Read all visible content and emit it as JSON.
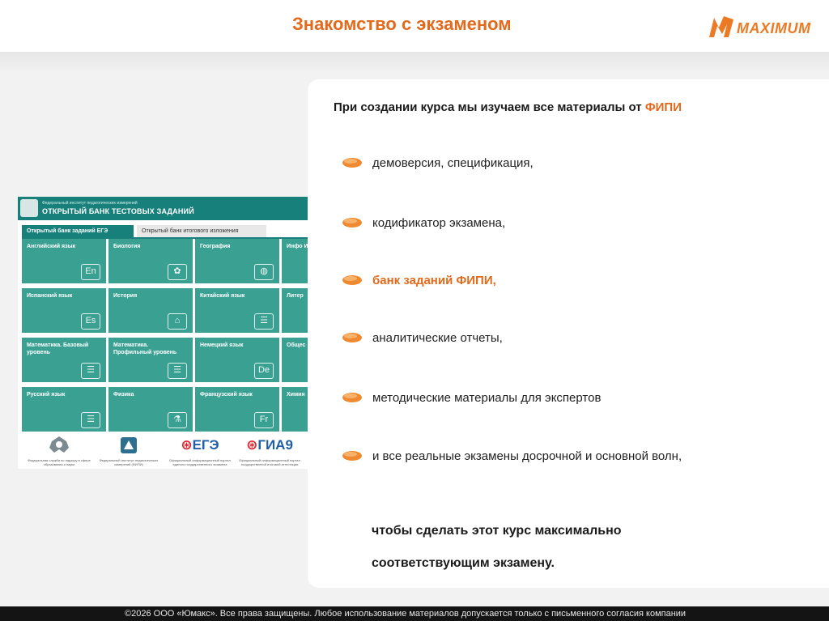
{
  "slide": {
    "title": "Знакомство с экзаменом",
    "brand": {
      "name": "MAXIMUM",
      "color": "#ec7a25",
      "icon": "maximum-logo-icon"
    },
    "accent_color": "#e26a1c"
  },
  "content": {
    "intro_prefix": "При создании курса мы изучаем все материалы от ",
    "intro_highlight": "ФИПИ",
    "bullets": [
      {
        "text": "демоверсия, спецификация,",
        "highlight": false
      },
      {
        "text": "кодификатор экзамена,",
        "highlight": false
      },
      {
        "text": "банк заданий ФИПИ,",
        "highlight": true
      },
      {
        "text": "аналитические отчеты,",
        "highlight": false
      },
      {
        "text": "методические материалы для экспертов",
        "highlight": false
      },
      {
        "text": "и все реальные экзамены досрочной и основной волн,",
        "highlight": false
      }
    ],
    "conclusion_line1": "чтобы сделать этот курс максимально",
    "conclusion_line2": "соответствующим экзамену."
  },
  "fipi": {
    "institute": "Федеральный институт педагогических измерений",
    "bank_title": "ОТКРЫТЫЙ БАНК ТЕСТОВЫХ ЗАДАНИЙ",
    "tab_active": "Открытый банк заданий ЕГЭ",
    "tab_inactive": "Открытый банк итогового изложения",
    "tile_color": "#3aa092",
    "header_color": "#17807b",
    "subjects": [
      {
        "label": "Английский язык",
        "icon": "En"
      },
      {
        "label": "Биология",
        "icon": "✿"
      },
      {
        "label": "География",
        "icon": "◍"
      },
      {
        "label": "Инфо ИКТ",
        "icon": ""
      },
      {
        "label": "Испанский язык",
        "icon": "Es"
      },
      {
        "label": "История",
        "icon": "⌂"
      },
      {
        "label": "Китайский язык",
        "icon": "☰"
      },
      {
        "label": "Литер",
        "icon": ""
      },
      {
        "label": "Математика. Базовый уровень",
        "icon": "☰"
      },
      {
        "label": "Математика. Профильный уровень",
        "icon": "☰"
      },
      {
        "label": "Немецкий язык",
        "icon": "De"
      },
      {
        "label": "Общес",
        "icon": ""
      },
      {
        "label": "Русский язык",
        "icon": "☰"
      },
      {
        "label": "Физика",
        "icon": "⚗"
      },
      {
        "label": "Французский язык",
        "icon": "Fr"
      },
      {
        "label": "Химия",
        "icon": ""
      }
    ],
    "footer_logos": [
      {
        "caption": "Федеральная служба по надзору в сфере образования и науки",
        "mark": "rosobrnadzor-emblem-icon"
      },
      {
        "caption": "Федеральный институт педагогических измерений (ФИПИ)",
        "mark": "fipi-emblem-icon"
      },
      {
        "big_left": "ЕГЭ",
        "caption": "Официальный информационный портал единого государственного экзамена",
        "mark": "ege-logo-icon"
      },
      {
        "big_left": "ГИА9",
        "caption": "Официальный информационный портал государственной итоговой аттестации",
        "mark": "gia9-logo-icon"
      }
    ]
  },
  "footer": {
    "copyright": "©2026 ООО «Юмакс». Все права защищены. Любое использование материалов допускается только с письменного согласия компании"
  }
}
